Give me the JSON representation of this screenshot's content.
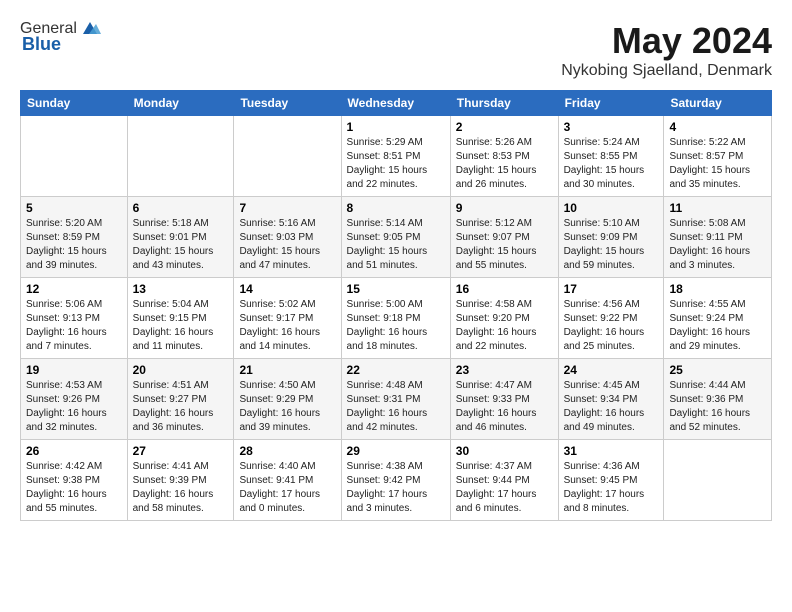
{
  "logo": {
    "general": "General",
    "blue": "Blue"
  },
  "title": "May 2024",
  "location": "Nykobing Sjaelland, Denmark",
  "weekdays": [
    "Sunday",
    "Monday",
    "Tuesday",
    "Wednesday",
    "Thursday",
    "Friday",
    "Saturday"
  ],
  "weeks": [
    [
      {
        "day": "",
        "info": ""
      },
      {
        "day": "",
        "info": ""
      },
      {
        "day": "",
        "info": ""
      },
      {
        "day": "1",
        "info": "Sunrise: 5:29 AM\nSunset: 8:51 PM\nDaylight: 15 hours\nand 22 minutes."
      },
      {
        "day": "2",
        "info": "Sunrise: 5:26 AM\nSunset: 8:53 PM\nDaylight: 15 hours\nand 26 minutes."
      },
      {
        "day": "3",
        "info": "Sunrise: 5:24 AM\nSunset: 8:55 PM\nDaylight: 15 hours\nand 30 minutes."
      },
      {
        "day": "4",
        "info": "Sunrise: 5:22 AM\nSunset: 8:57 PM\nDaylight: 15 hours\nand 35 minutes."
      }
    ],
    [
      {
        "day": "5",
        "info": "Sunrise: 5:20 AM\nSunset: 8:59 PM\nDaylight: 15 hours\nand 39 minutes."
      },
      {
        "day": "6",
        "info": "Sunrise: 5:18 AM\nSunset: 9:01 PM\nDaylight: 15 hours\nand 43 minutes."
      },
      {
        "day": "7",
        "info": "Sunrise: 5:16 AM\nSunset: 9:03 PM\nDaylight: 15 hours\nand 47 minutes."
      },
      {
        "day": "8",
        "info": "Sunrise: 5:14 AM\nSunset: 9:05 PM\nDaylight: 15 hours\nand 51 minutes."
      },
      {
        "day": "9",
        "info": "Sunrise: 5:12 AM\nSunset: 9:07 PM\nDaylight: 15 hours\nand 55 minutes."
      },
      {
        "day": "10",
        "info": "Sunrise: 5:10 AM\nSunset: 9:09 PM\nDaylight: 15 hours\nand 59 minutes."
      },
      {
        "day": "11",
        "info": "Sunrise: 5:08 AM\nSunset: 9:11 PM\nDaylight: 16 hours\nand 3 minutes."
      }
    ],
    [
      {
        "day": "12",
        "info": "Sunrise: 5:06 AM\nSunset: 9:13 PM\nDaylight: 16 hours\nand 7 minutes."
      },
      {
        "day": "13",
        "info": "Sunrise: 5:04 AM\nSunset: 9:15 PM\nDaylight: 16 hours\nand 11 minutes."
      },
      {
        "day": "14",
        "info": "Sunrise: 5:02 AM\nSunset: 9:17 PM\nDaylight: 16 hours\nand 14 minutes."
      },
      {
        "day": "15",
        "info": "Sunrise: 5:00 AM\nSunset: 9:18 PM\nDaylight: 16 hours\nand 18 minutes."
      },
      {
        "day": "16",
        "info": "Sunrise: 4:58 AM\nSunset: 9:20 PM\nDaylight: 16 hours\nand 22 minutes."
      },
      {
        "day": "17",
        "info": "Sunrise: 4:56 AM\nSunset: 9:22 PM\nDaylight: 16 hours\nand 25 minutes."
      },
      {
        "day": "18",
        "info": "Sunrise: 4:55 AM\nSunset: 9:24 PM\nDaylight: 16 hours\nand 29 minutes."
      }
    ],
    [
      {
        "day": "19",
        "info": "Sunrise: 4:53 AM\nSunset: 9:26 PM\nDaylight: 16 hours\nand 32 minutes."
      },
      {
        "day": "20",
        "info": "Sunrise: 4:51 AM\nSunset: 9:27 PM\nDaylight: 16 hours\nand 36 minutes."
      },
      {
        "day": "21",
        "info": "Sunrise: 4:50 AM\nSunset: 9:29 PM\nDaylight: 16 hours\nand 39 minutes."
      },
      {
        "day": "22",
        "info": "Sunrise: 4:48 AM\nSunset: 9:31 PM\nDaylight: 16 hours\nand 42 minutes."
      },
      {
        "day": "23",
        "info": "Sunrise: 4:47 AM\nSunset: 9:33 PM\nDaylight: 16 hours\nand 46 minutes."
      },
      {
        "day": "24",
        "info": "Sunrise: 4:45 AM\nSunset: 9:34 PM\nDaylight: 16 hours\nand 49 minutes."
      },
      {
        "day": "25",
        "info": "Sunrise: 4:44 AM\nSunset: 9:36 PM\nDaylight: 16 hours\nand 52 minutes."
      }
    ],
    [
      {
        "day": "26",
        "info": "Sunrise: 4:42 AM\nSunset: 9:38 PM\nDaylight: 16 hours\nand 55 minutes."
      },
      {
        "day": "27",
        "info": "Sunrise: 4:41 AM\nSunset: 9:39 PM\nDaylight: 16 hours\nand 58 minutes."
      },
      {
        "day": "28",
        "info": "Sunrise: 4:40 AM\nSunset: 9:41 PM\nDaylight: 17 hours\nand 0 minutes."
      },
      {
        "day": "29",
        "info": "Sunrise: 4:38 AM\nSunset: 9:42 PM\nDaylight: 17 hours\nand 3 minutes."
      },
      {
        "day": "30",
        "info": "Sunrise: 4:37 AM\nSunset: 9:44 PM\nDaylight: 17 hours\nand 6 minutes."
      },
      {
        "day": "31",
        "info": "Sunrise: 4:36 AM\nSunset: 9:45 PM\nDaylight: 17 hours\nand 8 minutes."
      },
      {
        "day": "",
        "info": ""
      }
    ]
  ]
}
